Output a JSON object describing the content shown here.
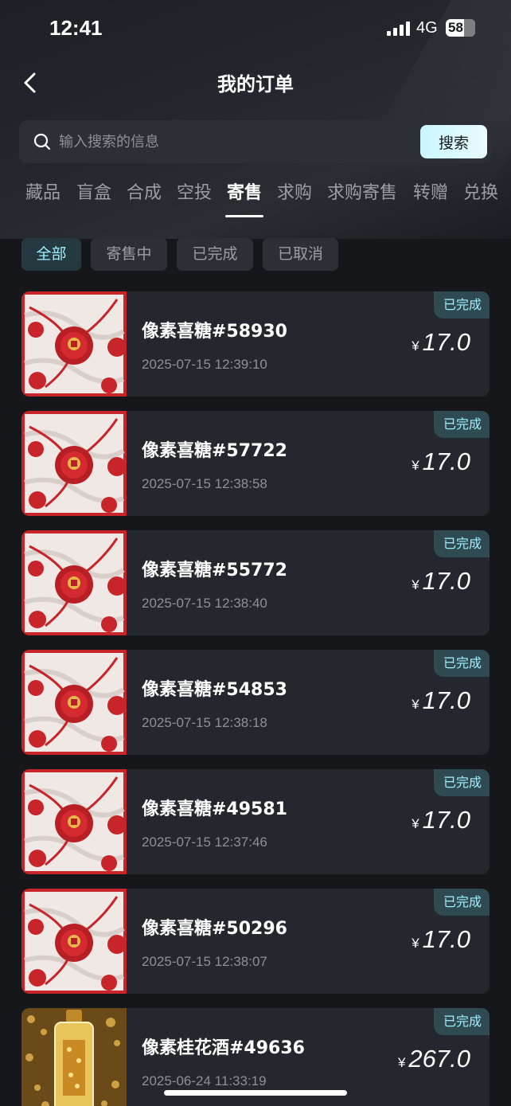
{
  "status_bar": {
    "time": "12:41",
    "network": "4G",
    "battery": "58"
  },
  "header": {
    "title": "我的订单"
  },
  "search": {
    "placeholder": "输入搜索的信息",
    "button_label": "搜索"
  },
  "tabs": [
    {
      "label": "藏品"
    },
    {
      "label": "盲盒"
    },
    {
      "label": "合成"
    },
    {
      "label": "空投"
    },
    {
      "label": "寄售",
      "active": true
    },
    {
      "label": "求购"
    },
    {
      "label": "求购寄售"
    },
    {
      "label": "转赠"
    },
    {
      "label": "兑换"
    }
  ],
  "filters": [
    {
      "label": "全部",
      "active": true
    },
    {
      "label": "寄售中"
    },
    {
      "label": "已完成"
    },
    {
      "label": "已取消"
    }
  ],
  "orders": [
    {
      "name": "像素喜糖#58930",
      "date": "2025-07-15 12:39:10",
      "status": "已完成",
      "currency": "¥",
      "price": "17.0",
      "image": "red-candy"
    },
    {
      "name": "像素喜糖#57722",
      "date": "2025-07-15 12:38:58",
      "status": "已完成",
      "currency": "¥",
      "price": "17.0",
      "image": "red-candy"
    },
    {
      "name": "像素喜糖#55772",
      "date": "2025-07-15 12:38:40",
      "status": "已完成",
      "currency": "¥",
      "price": "17.0",
      "image": "red-candy"
    },
    {
      "name": "像素喜糖#54853",
      "date": "2025-07-15 12:38:18",
      "status": "已完成",
      "currency": "¥",
      "price": "17.0",
      "image": "red-candy"
    },
    {
      "name": "像素喜糖#49581",
      "date": "2025-07-15 12:37:46",
      "status": "已完成",
      "currency": "¥",
      "price": "17.0",
      "image": "red-candy"
    },
    {
      "name": "像素喜糖#50296",
      "date": "2025-07-15 12:38:07",
      "status": "已完成",
      "currency": "¥",
      "price": "17.0",
      "image": "red-candy"
    },
    {
      "name": "像素桂花酒#49636",
      "date": "2025-06-24 11:33:19",
      "status": "已完成",
      "currency": "¥",
      "price": "267.0",
      "image": "osmanthus-wine"
    }
  ],
  "colors": {
    "background": "#15171b",
    "card": "#24272d",
    "accent": "#9ff0ff",
    "badge_bg": "#2f4a50"
  }
}
